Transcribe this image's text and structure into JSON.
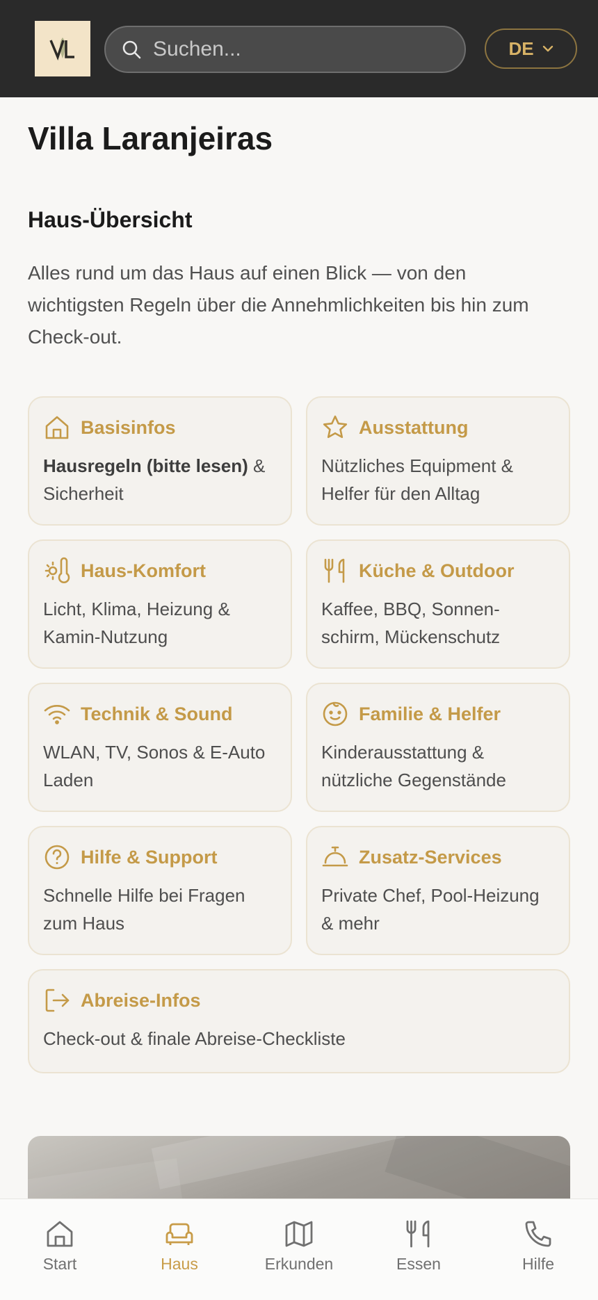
{
  "header": {
    "logo_text": "VL",
    "search_placeholder": "Suchen...",
    "language": "DE"
  },
  "page": {
    "title": "Villa Laranjeiras",
    "section_title": "Haus-Übersicht",
    "intro": "Alles rund um das Haus auf einen Blick — von den wichtigsten Regeln über die Annehmlichkeiten bis hin zum Check-out."
  },
  "cards": [
    {
      "icon": "house-icon",
      "title": "Basisinfos",
      "desc_bold": "Hausregeln (bitte lesen)",
      "desc": " & Sicherheit"
    },
    {
      "icon": "star-icon",
      "title": "Ausstattung",
      "desc": "Nützliches Equipment & Helfer für den Alltag"
    },
    {
      "icon": "sun-thermometer-icon",
      "title": "Haus-Komfort",
      "desc": "Licht, Klima, Heizung & Kamin-Nutzung"
    },
    {
      "icon": "fork-knife-icon",
      "title": "Küche & Outdoor",
      "desc": "Kaffee, BBQ, Sonnen-schirm, Mückenschutz"
    },
    {
      "icon": "wifi-icon",
      "title": "Technik & Sound",
      "desc": "WLAN, TV, Sonos & E-Auto Laden"
    },
    {
      "icon": "baby-face-icon",
      "title": "Familie & Helfer",
      "desc": "Kinderausstattung & nützliche Gegenstände"
    },
    {
      "icon": "help-circle-icon",
      "title": "Hilfe & Support",
      "desc": "Schnelle Hilfe bei Fragen zum Haus"
    },
    {
      "icon": "service-bell-icon",
      "title": "Zusatz-Services",
      "desc": "Private Chef, Pool-Heizung & mehr"
    },
    {
      "icon": "exit-icon",
      "title": "Abreise-Infos",
      "desc": "Check-out & finale Abreise-Checkliste"
    }
  ],
  "nav": {
    "items": [
      {
        "icon": "home-icon",
        "label": "Start"
      },
      {
        "icon": "sofa-icon",
        "label": "Haus"
      },
      {
        "icon": "map-icon",
        "label": "Erkunden"
      },
      {
        "icon": "fork-knife-icon",
        "label": "Essen"
      },
      {
        "icon": "phone-icon",
        "label": "Hilfe"
      }
    ],
    "active": "Haus"
  },
  "colors": {
    "accent": "#c49a48",
    "header_bg": "#2a2a2a",
    "card_bg": "#f4f2ee",
    "card_border": "#ebe3d2"
  }
}
